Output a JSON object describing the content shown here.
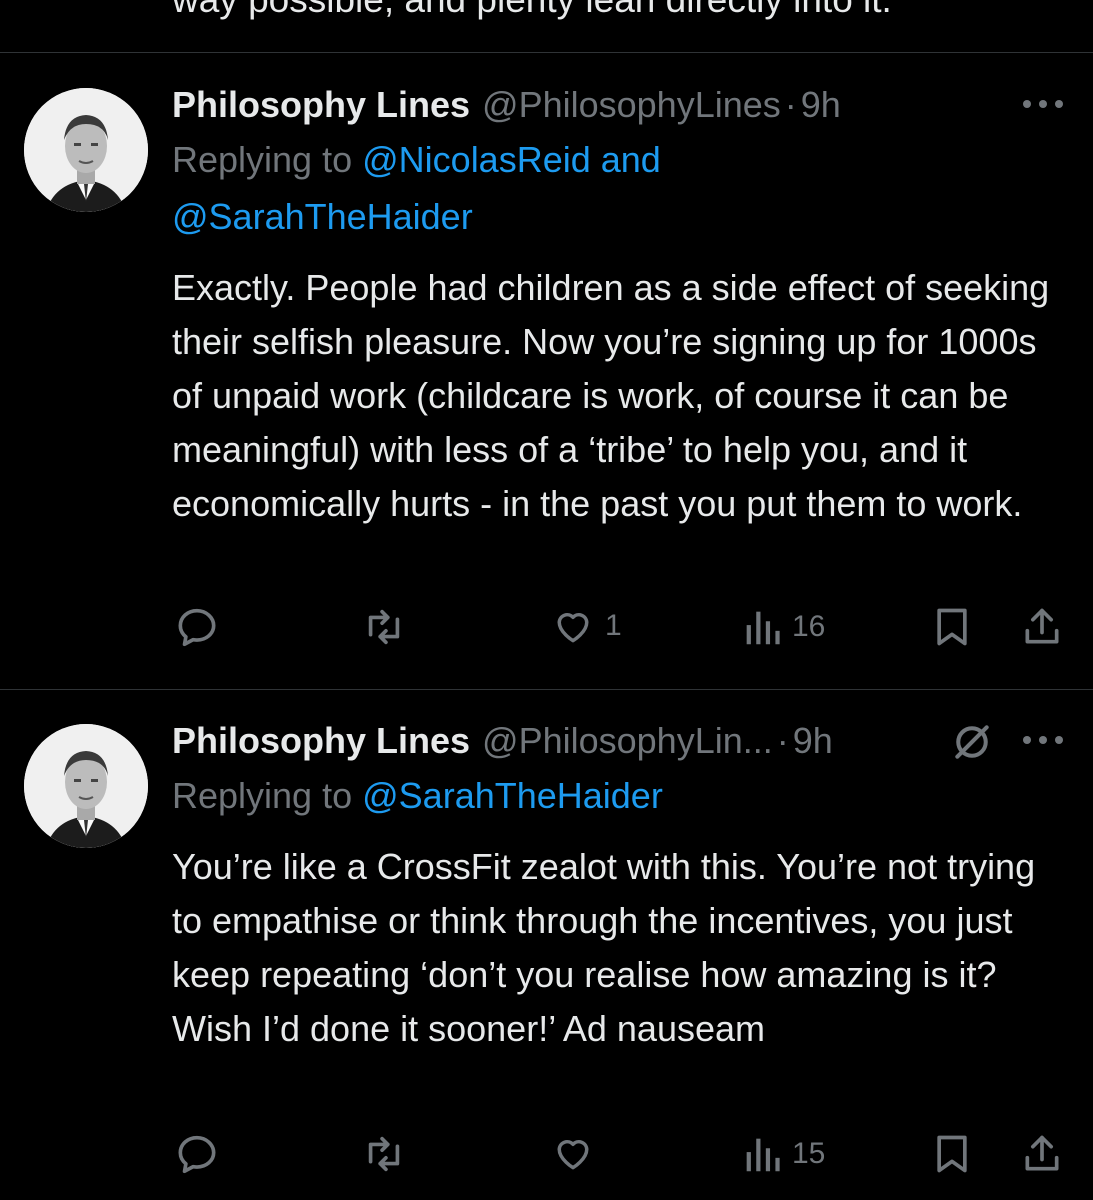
{
  "top_fragment": "way possible, and plenty lean directly into it.",
  "tweets": [
    {
      "name": "Philosophy Lines",
      "handle": "@PhilosophyLines",
      "dot": "·",
      "time": "9h",
      "replying_prefix": "Replying to",
      "replying_to_1": "@NicolasReid",
      "replying_join": "and",
      "replying_to_2": "@SarahTheHaider",
      "text": "Exactly. People had children as a side effect of seeking their selfish pleasure. Now you’re signing up for 1000s of unpaid work (childcare is work, of course it can be meaningful) with less of a ‘tribe’ to help you, and it economically hurts - in the past you put them to work.",
      "likes": "1",
      "views": "16"
    },
    {
      "name": "Philosophy Lines",
      "handle": "@PhilosophyLin...",
      "dot": "·",
      "time": "9h",
      "replying_prefix": "Replying to",
      "replying_to_1": "@SarahTheHaider",
      "text": "You’re like a CrossFit zealot with this. You’re not trying to empathise or think through the incentives, you just keep repeating ‘don’t you realise how amazing is it? Wish I’d done it sooner!’ Ad nauseam",
      "likes": "",
      "views": "15"
    }
  ],
  "icons": {
    "reply": "reply-icon",
    "retweet": "retweet-icon",
    "like": "heart-icon",
    "views": "views-icon",
    "bookmark": "bookmark-icon",
    "share": "share-icon",
    "more": "more-icon",
    "muted": "muted-icon"
  },
  "colors": {
    "background": "#000000",
    "text": "#e7e9ea",
    "secondary": "#71767b",
    "link": "#1d9bf0",
    "divider": "#2f3336"
  }
}
